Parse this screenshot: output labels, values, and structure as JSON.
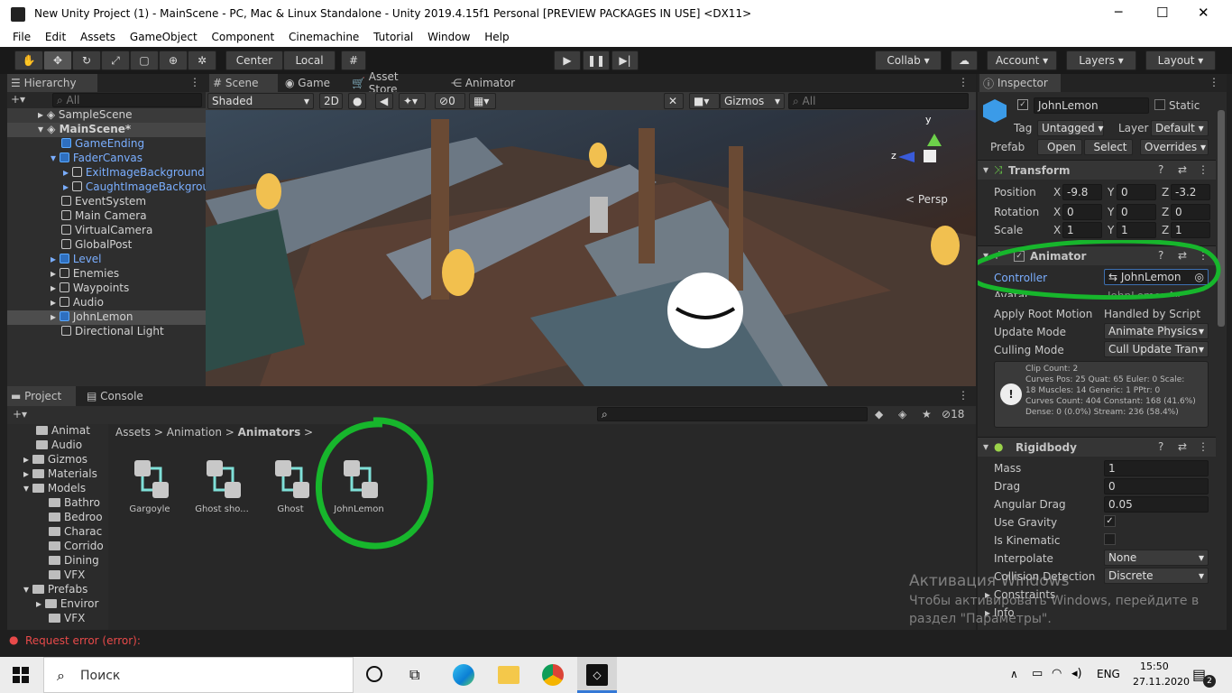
{
  "window": {
    "title": "New Unity Project (1) - MainScene - PC, Mac & Linux Standalone - Unity 2019.4.15f1 Personal [PREVIEW PACKAGES IN USE] <DX11>",
    "min": "─",
    "max": "☐",
    "close": "✕"
  },
  "menu": [
    "File",
    "Edit",
    "Assets",
    "GameObject",
    "Component",
    "Cinemachine",
    "Tutorial",
    "Window",
    "Help"
  ],
  "toolbar": {
    "center": "Center",
    "local": "Local",
    "collab": "Collab",
    "account": "Account",
    "layers": "Layers",
    "layout": "Layout"
  },
  "hierarchy": {
    "tab": "Hierarchy",
    "search_placeholder": "All",
    "items": [
      {
        "label": "SampleScene",
        "type": "scene"
      },
      {
        "label": "MainScene*",
        "type": "scene"
      },
      {
        "label": "GameEnding",
        "type": "prefab"
      },
      {
        "label": "FaderCanvas",
        "type": "prefab"
      },
      {
        "label": "ExitImageBackground",
        "type": "prefab"
      },
      {
        "label": "CaughtImageBackgrou",
        "type": "prefab"
      },
      {
        "label": "EventSystem",
        "type": "obj"
      },
      {
        "label": "Main Camera",
        "type": "obj"
      },
      {
        "label": "VirtualCamera",
        "type": "obj"
      },
      {
        "label": "GlobalPost",
        "type": "obj"
      },
      {
        "label": "Level",
        "type": "prefab"
      },
      {
        "label": "Enemies",
        "type": "obj"
      },
      {
        "label": "Waypoints",
        "type": "obj"
      },
      {
        "label": "Audio",
        "type": "obj"
      },
      {
        "label": "JohnLemon",
        "type": "prefab"
      },
      {
        "label": "Directional Light",
        "type": "obj"
      }
    ]
  },
  "scene": {
    "tabs": [
      "Scene",
      "Game",
      "Asset Store",
      "Animator"
    ],
    "shading": "Shaded",
    "mode2d": "2D",
    "hidden_count": "0",
    "gizmos": "Gizmos",
    "search_placeholder": "All",
    "persp": "< Persp",
    "axis_y": "y",
    "axis_z": "z"
  },
  "project": {
    "tabs": [
      "Project",
      "Console"
    ],
    "badge": "18",
    "breadcrumb": [
      "Assets",
      "Animation",
      "Animators"
    ],
    "tree": [
      "Animat",
      "Audio",
      "Gizmos",
      "Materials",
      "Models",
      "Bathro",
      "Bedroo",
      "Charac",
      "Corrido",
      "Dining",
      "VFX",
      "Prefabs",
      "Enviror",
      "VFX"
    ],
    "assets": [
      "Gargoyle",
      "Ghost sho...",
      "Ghost",
      "JohnLemon"
    ]
  },
  "status": {
    "error": "Request error (error):"
  },
  "inspector": {
    "tab": "Inspector",
    "name": "JohnLemon",
    "static": "Static",
    "tag_label": "Tag",
    "tag": "Untagged",
    "layer_label": "Layer",
    "layer": "Default",
    "prefab_label": "Prefab",
    "open": "Open",
    "select": "Select",
    "overrides": "Overrides",
    "transform": {
      "title": "Transform",
      "position": "Position",
      "rotation": "Rotation",
      "scale": "Scale",
      "pos": [
        "-9.8",
        "0",
        "-3.2"
      ],
      "rot": [
        "0",
        "0",
        "0"
      ],
      "scl": [
        "1",
        "1",
        "1"
      ]
    },
    "animator": {
      "title": "Animator",
      "controller_label": "Controller",
      "controller": "JohnLemon",
      "avatar_label": "Avatar",
      "avatar": "JohnLemonAv",
      "root_label": "Apply Root Motion",
      "root": "Handled by Script",
      "update_label": "Update Mode",
      "update": "Animate Physics",
      "culling_label": "Culling Mode",
      "culling": "Cull Update Trans",
      "info": [
        "Clip Count: 2",
        "Curves Pos: 25 Quat: 65 Euler: 0 Scale:",
        "18 Muscles: 14 Generic: 1 PPtr: 0",
        "Curves Count: 404 Constant: 168 (41.6%)",
        "Dense: 0 (0.0%) Stream: 236 (58.4%)"
      ]
    },
    "rigidbody": {
      "title": "Rigidbody",
      "mass_label": "Mass",
      "mass": "1",
      "drag_label": "Drag",
      "drag": "0",
      "ang_label": "Angular Drag",
      "ang": "0.05",
      "grav_label": "Use Gravity",
      "kin_label": "Is Kinematic",
      "interp_label": "Interpolate",
      "interp": "None",
      "coll_label": "Collision Detection",
      "coll": "Discrete",
      "constraints": "Constraints",
      "info": "Info"
    }
  },
  "watermark": {
    "line1": "Активация Windows",
    "line2": "Чтобы активировать Windows, перейдите в",
    "line3": "раздел \"Параметры\"."
  },
  "taskbar": {
    "search": "Поиск",
    "lang": "ENG",
    "time": "15:50",
    "date": "27.11.2020",
    "notif": "2"
  }
}
